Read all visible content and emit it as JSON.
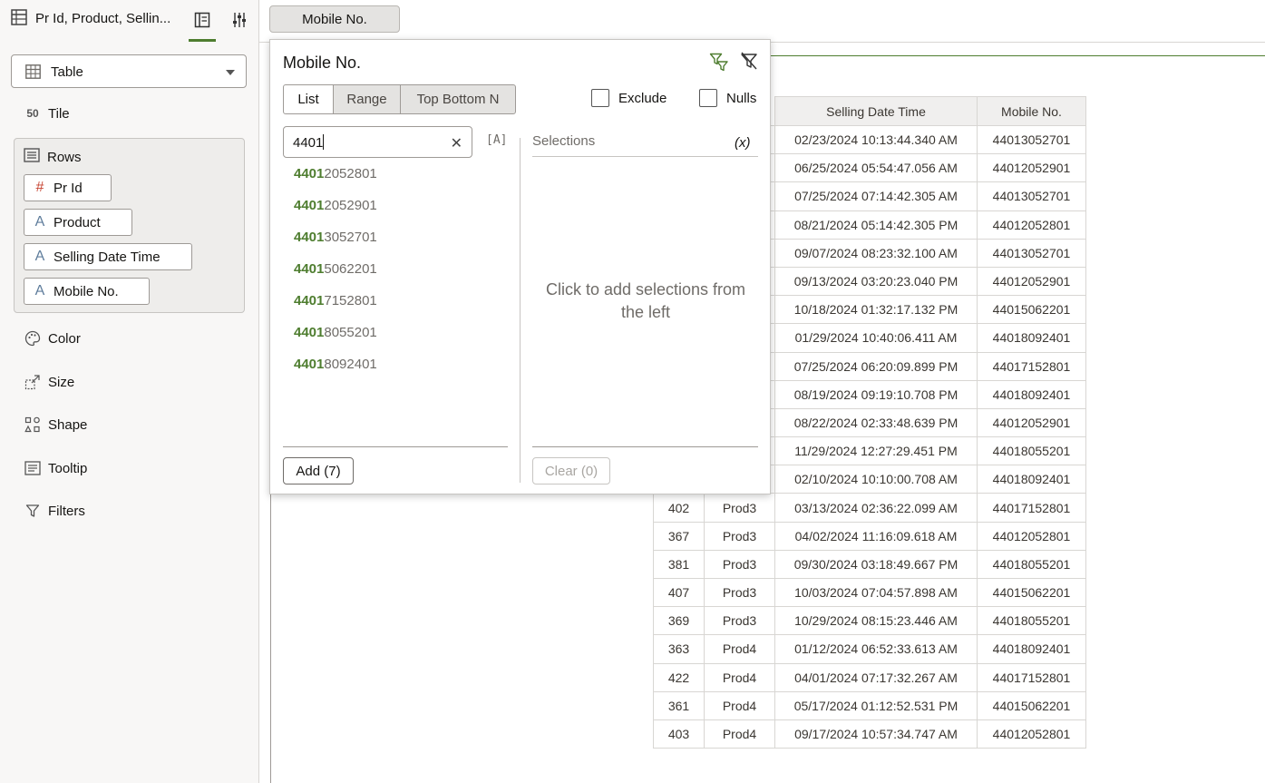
{
  "header": {
    "title": "Pr Id, Product, Sellin..."
  },
  "viz_type": "Table",
  "grammar": {
    "tile": "Tile",
    "rows_label": "Rows",
    "rows": [
      {
        "label": "Pr Id",
        "type_icon": "#"
      },
      {
        "label": "Product",
        "type_icon": "A"
      },
      {
        "label": "Selling Date Time",
        "type_icon": "A"
      },
      {
        "label": "Mobile No.",
        "type_icon": "A"
      }
    ],
    "color": "Color",
    "size": "Size",
    "shape": "Shape",
    "tooltip": "Tooltip",
    "filters": "Filters"
  },
  "filter_bar": {
    "pill_label": "Mobile No."
  },
  "popup": {
    "title": "Mobile No.",
    "tabs": [
      "List",
      "Range",
      "Top Bottom N"
    ],
    "exclude_label": "Exclude",
    "nulls_label": "Nulls",
    "search_value": "4401",
    "case_icon": "[A]",
    "values": [
      {
        "match": "4401",
        "rest": "2052801"
      },
      {
        "match": "4401",
        "rest": "2052901"
      },
      {
        "match": "4401",
        "rest": "3052701"
      },
      {
        "match": "4401",
        "rest": "5062201"
      },
      {
        "match": "4401",
        "rest": "7152801"
      },
      {
        "match": "4401",
        "rest": "8055201"
      },
      {
        "match": "4401",
        "rest": "8092401"
      }
    ],
    "add_label": "Add (7)",
    "selections_label": "Selections",
    "selections_x": "(x)",
    "selections_empty": "Click to add selections from the left",
    "clear_label": "Clear (0)"
  },
  "table": {
    "columns": [
      "",
      "",
      "Selling Date Time",
      "Mobile No."
    ],
    "rows": [
      [
        "",
        "",
        "02/23/2024 10:13:44.340 AM",
        "44013052701"
      ],
      [
        "",
        "",
        "06/25/2024 05:54:47.056 AM",
        "44012052901"
      ],
      [
        "",
        "",
        "07/25/2024 07:14:42.305 AM",
        "44013052701"
      ],
      [
        "",
        "",
        "08/21/2024 05:14:42.305 PM",
        "44012052801"
      ],
      [
        "",
        "",
        "09/07/2024 08:23:32.100 AM",
        "44013052701"
      ],
      [
        "",
        "",
        "09/13/2024 03:20:23.040 PM",
        "44012052901"
      ],
      [
        "",
        "",
        "10/18/2024 01:32:17.132 PM",
        "44015062201"
      ],
      [
        "",
        "",
        "01/29/2024 10:40:06.411 AM",
        "44018092401"
      ],
      [
        "",
        "",
        "07/25/2024 06:20:09.899 PM",
        "44017152801"
      ],
      [
        "",
        "",
        "08/19/2024 09:19:10.708 PM",
        "44018092401"
      ],
      [
        "",
        "",
        "08/22/2024 02:33:48.639 PM",
        "44012052901"
      ],
      [
        "",
        "",
        "11/29/2024 12:27:29.451 PM",
        "44018055201"
      ],
      [
        "",
        "",
        "02/10/2024 10:10:00.708 AM",
        "44018092401"
      ],
      [
        "402",
        "Prod3",
        "03/13/2024 02:36:22.099 AM",
        "44017152801"
      ],
      [
        "367",
        "Prod3",
        "04/02/2024 11:16:09.618 AM",
        "44012052801"
      ],
      [
        "381",
        "Prod3",
        "09/30/2024 03:18:49.667 PM",
        "44018055201"
      ],
      [
        "407",
        "Prod3",
        "10/03/2024 07:04:57.898 AM",
        "44015062201"
      ],
      [
        "369",
        "Prod3",
        "10/29/2024 08:15:23.446 AM",
        "44018055201"
      ],
      [
        "363",
        "Prod4",
        "01/12/2024 06:52:33.613 AM",
        "44018092401"
      ],
      [
        "422",
        "Prod4",
        "04/01/2024 07:17:32.267 AM",
        "44017152801"
      ],
      [
        "361",
        "Prod4",
        "05/17/2024 01:12:52.531 PM",
        "44015062201"
      ],
      [
        "403",
        "Prod4",
        "09/17/2024 10:57:34.747 AM",
        "44012052801"
      ]
    ]
  },
  "colors": {
    "accent": "#4e7d2f",
    "number_icon": "#c74634",
    "text_icon": "#5f7d9c"
  }
}
